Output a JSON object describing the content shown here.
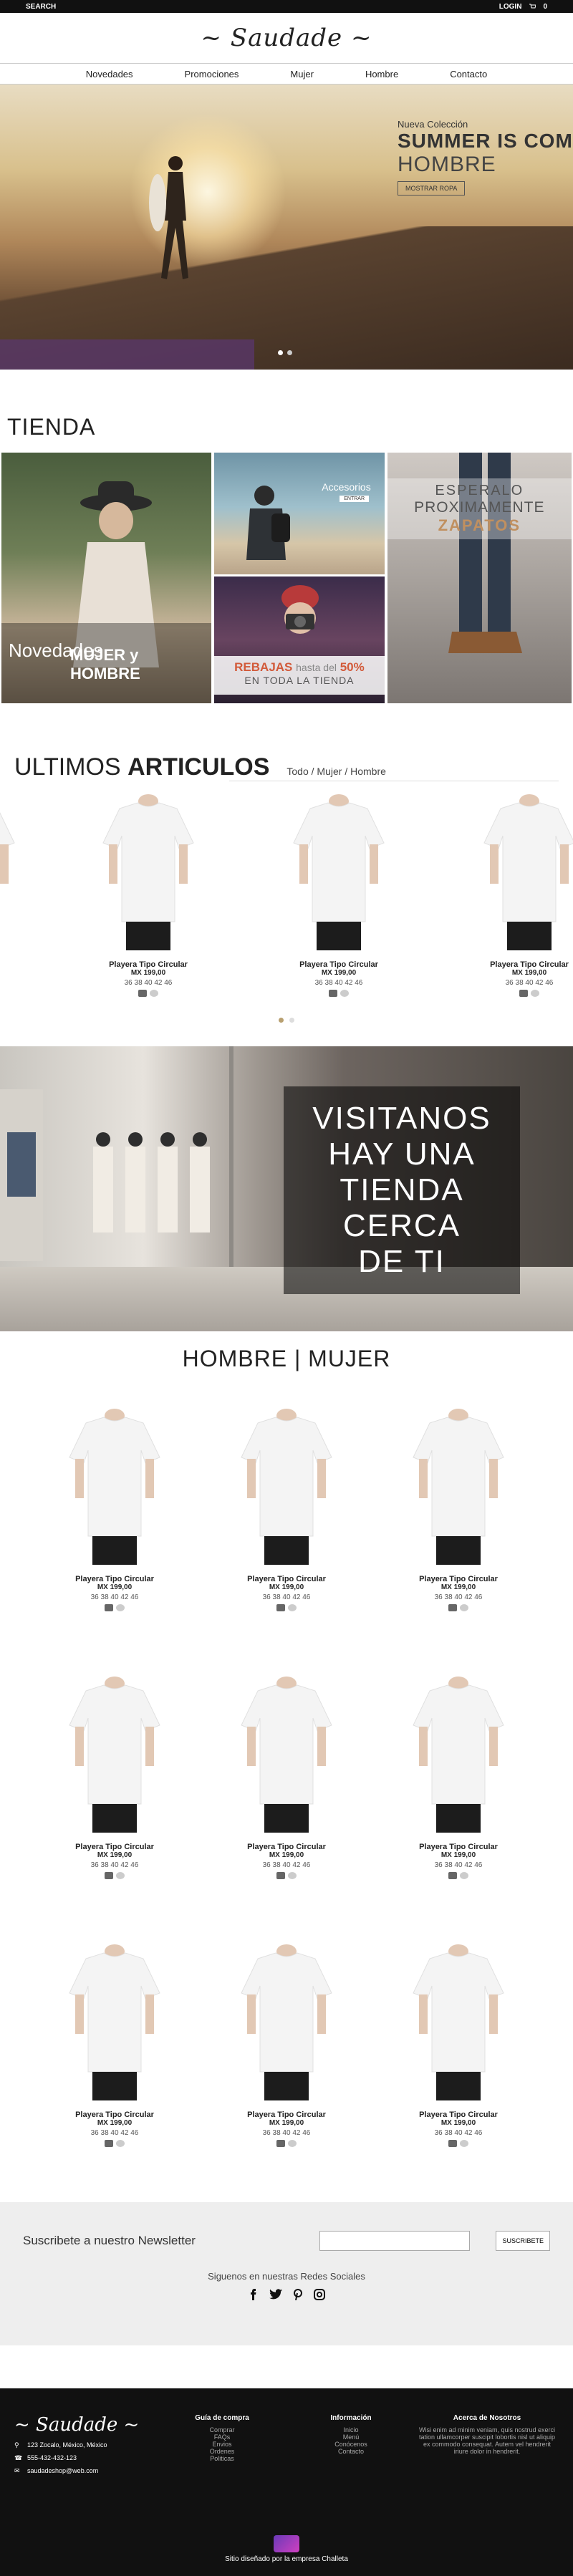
{
  "topbar": {
    "search": "SEARCH",
    "login": "LOGIN",
    "cart_count": "0"
  },
  "logo": "~ Saudade ~",
  "nav": [
    "Novedades",
    "Promociones",
    "Mujer",
    "Hombre",
    "Contacto"
  ],
  "hero": {
    "subtitle": "Nueva Colección",
    "headline": "SUMMER IS COMI",
    "category": "HOMBRE",
    "button": "MOSTRAR ROPA"
  },
  "tienda": {
    "title": "TIENDA",
    "tile_a": {
      "line1": "Novedades",
      "line2": "MUJER y HOMBRE"
    },
    "tile_b": {
      "label": "Accesorios",
      "tag": "ENTRAR"
    },
    "tile_c": {
      "line1_a": "REBAJAS",
      "line1_b": "hasta del",
      "line1_c": "50%",
      "line2": "EN TODA LA TIENDA"
    },
    "tile_d": {
      "line1": "ESPERALO",
      "line2": "PROXIMAMENTE",
      "line3": "ZAPATOS"
    }
  },
  "ultimos": {
    "title_light": "ULTIMOS",
    "title_bold": "ARTICULOS",
    "filters": "Todo / Mujer / Hombre"
  },
  "product": {
    "name": "Playera Tipo Circular",
    "price": "MX 199,00",
    "sizes": "36 38 40 42 46"
  },
  "store_banner": [
    "VISITANOS",
    "HAY UNA",
    "TIENDA",
    "CERCA",
    "DE TI"
  ],
  "hombre_mujer": "HOMBRE  |  MUJER",
  "newsletter": {
    "label": "Suscribete a nuestro Newsletter",
    "button": "SUSCRIBETE",
    "social_title": "Siguenos en nuestras Redes Sociales"
  },
  "footer": {
    "logo": "~ Saudade ~",
    "address": "123 Zocalo, México, México",
    "phone": "555-432-432-123",
    "email": "saudadeshop@web.com",
    "guia_title": "Guía de compra",
    "guia": [
      "Comprar",
      "FAQs",
      "Envios",
      "Ordenes",
      "Politicas"
    ],
    "info_title": "Información",
    "info": [
      "Inicio",
      "Menú",
      "Conócenos",
      "Contacto"
    ],
    "about_title": "Acerca de Nosotros",
    "about_text": "Wisi enim ad minim veniam, quis nostrud exerci tation ullamcorper suscipit lobortis nisl ut aliquip ex commodo consequat. Autem vel hendrerit iriure dolor in hendrerit.",
    "credit": "Sitio diseñado por la empresa Challeta"
  }
}
